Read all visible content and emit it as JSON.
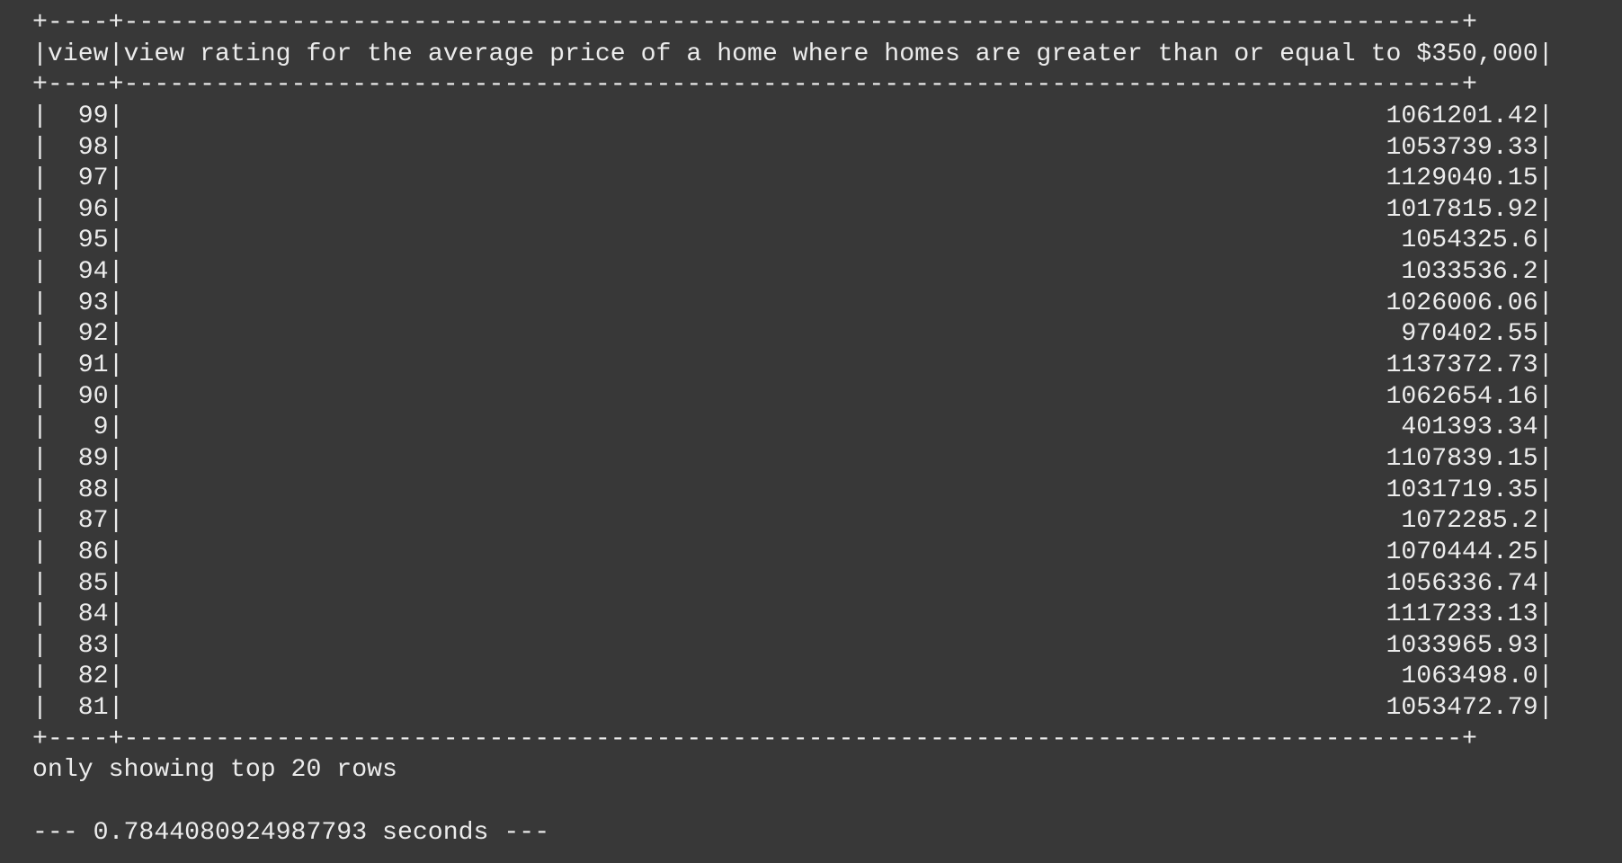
{
  "table": {
    "border": "+----+----------------------------------------------------------------------------------------+",
    "headers": [
      "view",
      "view rating for the average price of a home where homes are greater than or equal to $350,000"
    ],
    "rows": [
      [
        "99",
        "1061201.42"
      ],
      [
        "98",
        "1053739.33"
      ],
      [
        "97",
        "1129040.15"
      ],
      [
        "96",
        "1017815.92"
      ],
      [
        "95",
        "1054325.6"
      ],
      [
        "94",
        "1033536.2"
      ],
      [
        "93",
        "1026006.06"
      ],
      [
        "92",
        "970402.55"
      ],
      [
        "91",
        "1137372.73"
      ],
      [
        "90",
        "1062654.16"
      ],
      [
        "9",
        "401393.34"
      ],
      [
        "89",
        "1107839.15"
      ],
      [
        "88",
        "1031719.35"
      ],
      [
        "87",
        "1072285.2"
      ],
      [
        "86",
        "1070444.25"
      ],
      [
        "85",
        "1056336.74"
      ],
      [
        "84",
        "1117233.13"
      ],
      [
        "83",
        "1033965.93"
      ],
      [
        "82",
        "1063498.0"
      ],
      [
        "81",
        "1053472.79"
      ]
    ]
  },
  "footer_note": "only showing top 20 rows",
  "timing": "--- 0.7844080924987793 seconds ---"
}
